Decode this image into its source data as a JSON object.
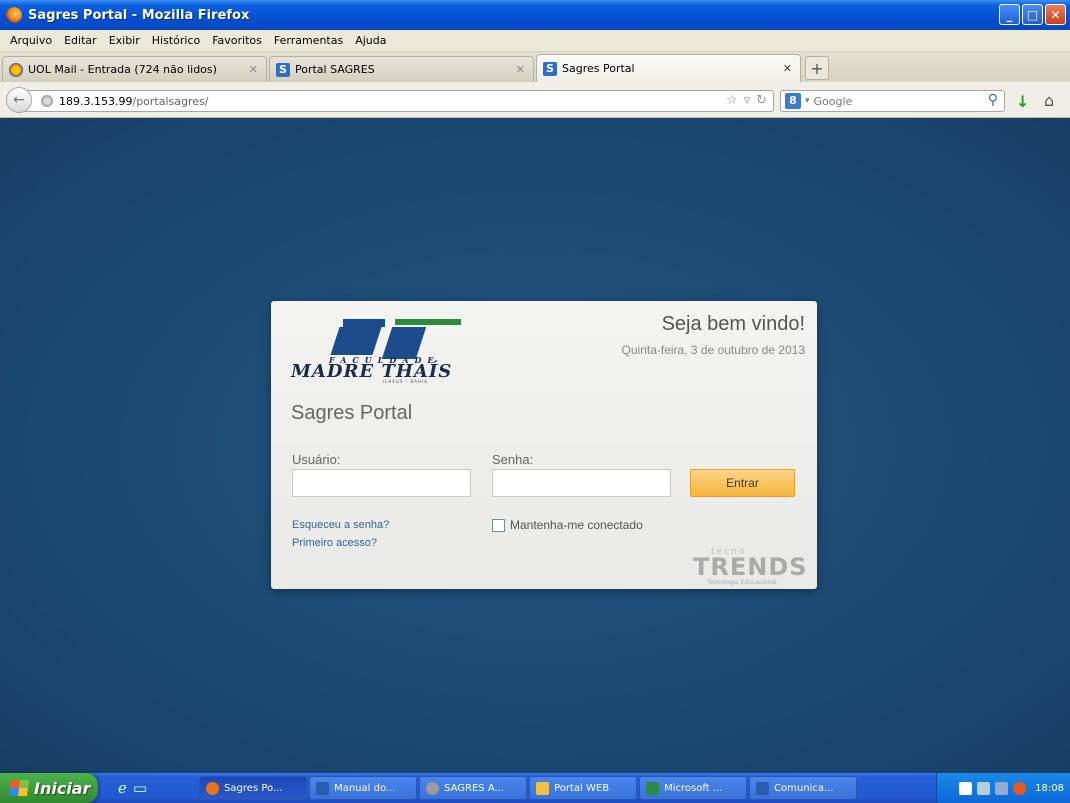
{
  "window": {
    "title": "Sagres Portal - Mozilla Firefox",
    "buttons": {
      "minimize": "_",
      "maximize": "□",
      "close": "✕"
    }
  },
  "menu": [
    "Arquivo",
    "Editar",
    "Exibir",
    "Histórico",
    "Favoritos",
    "Ferramentas",
    "Ajuda"
  ],
  "tabs": [
    {
      "label": "UOL Mail - Entrada (724 não lidos)",
      "icon": "uol-icon",
      "active": false
    },
    {
      "label": "Portal SAGRES",
      "icon": "s-icon",
      "active": false
    },
    {
      "label": "Sagres Portal",
      "icon": "s-icon",
      "active": true
    }
  ],
  "nav": {
    "url_host": "189.3.153.99",
    "url_path": "/portalsagres/",
    "search_engine": "Google"
  },
  "login": {
    "welcome": "Seja bem vindo!",
    "date": "Quinta-feira, 3 de outubro de 2013",
    "portal_title": "Sagres Portal",
    "user_label": "Usuário:",
    "user_value": "",
    "pass_label": "Senha:",
    "pass_value": "",
    "submit": "Entrar",
    "forgot": "Esqueceu a senha?",
    "first_access": "Primeiro acesso?",
    "remember": "Mantenha-me conectado",
    "remember_checked": false
  },
  "logo": {
    "faculdade": "FACULDADE",
    "name": "MADRE THAÍS",
    "sub": "ILHÉUS - BAHIA"
  },
  "vendor": {
    "tecno": "tecno",
    "trends": "TRENDS",
    "tagline": "Tecnologia Educacional"
  },
  "taskbar": {
    "start": "Iniciar",
    "items": [
      {
        "label": "Sagres Po...",
        "color": "#e8751a",
        "active": true
      },
      {
        "label": "Manual do...",
        "color": "#2a5db0",
        "active": false
      },
      {
        "label": "SAGRES A...",
        "color": "#9a9a9a",
        "active": false
      },
      {
        "label": "Portal WEB",
        "color": "#f0c040",
        "active": false
      },
      {
        "label": "Microsoft ...",
        "color": "#2a8a4a",
        "active": false
      },
      {
        "label": "Comunica...",
        "color": "#2a5db0",
        "active": false
      }
    ],
    "clock": "18:08"
  },
  "colors": {
    "page_bg": "#1c4a72",
    "accent_button": "#f6b53a",
    "link": "#3465a4"
  }
}
